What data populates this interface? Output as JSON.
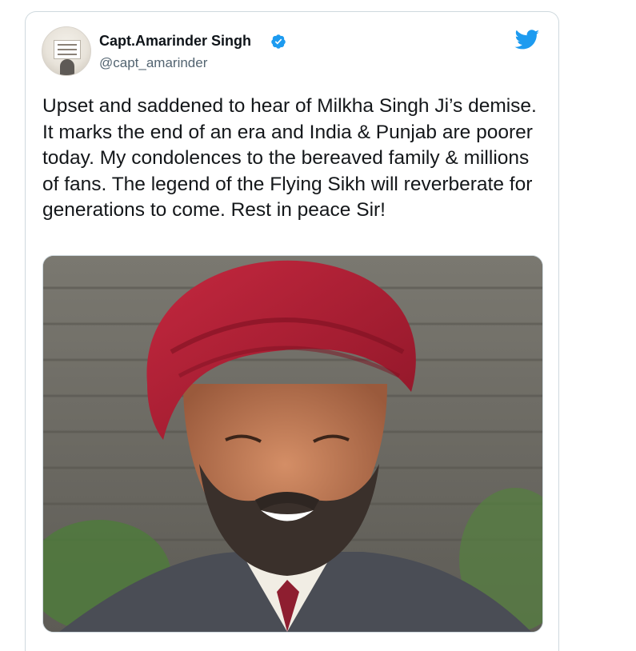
{
  "tweet": {
    "author": {
      "display_name": "Capt.Amarinder Singh",
      "handle": "@capt_amarinder",
      "verified": true,
      "avatar_icon": "profile-photo-avatar"
    },
    "platform_icon": "twitter-bird-icon",
    "text": "Upset and saddened to hear of Milkha Singh Ji’s demise. It marks the end of an era and India & Punjab are poorer today. My condolences to the bereaved family & millions of fans. The legend of the Flying Sikh will reverberate for generations to come. Rest in peace Sir!",
    "media": {
      "type": "photo",
      "subject": "smiling man in red turban and grey beard"
    }
  },
  "colors": {
    "twitter_blue": "#1d9bf0",
    "name_text": "#0f1419",
    "handle_text": "#536471",
    "body_text": "#14171a",
    "card_border": "#cfd9de",
    "turban_red": "#b5203a"
  }
}
